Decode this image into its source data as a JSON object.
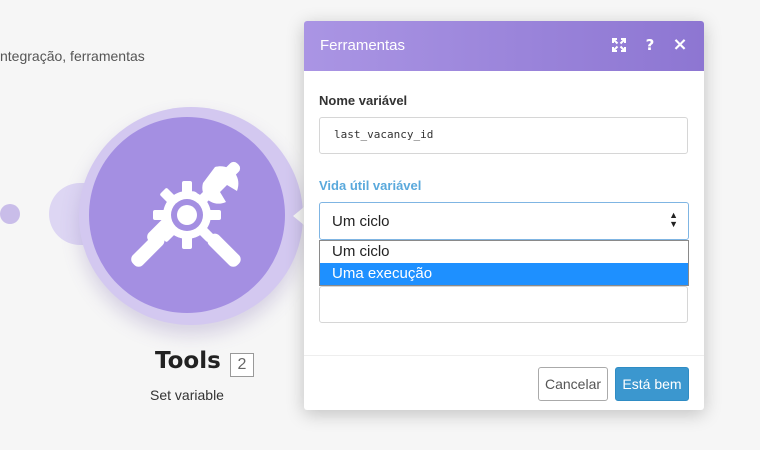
{
  "breadcrumb": "ntegração, ferramentas",
  "module": {
    "title": "Tools",
    "number": "2",
    "subtitle": "Set variable",
    "icon": "tools-gear-icon",
    "color": "#a48fe2"
  },
  "dialog": {
    "title": "Ferramentas",
    "header_icons": [
      "expand-icon",
      "help-icon",
      "close-icon"
    ],
    "help_glyph": "?",
    "close_glyph": "×",
    "field_name_label": "Nome variável",
    "field_name_value": "last_vacancy_id",
    "lifetime_label": "Vida útil variável",
    "lifetime_selected": "Um ciclo",
    "lifetime_options": [
      "Um ciclo",
      "Uma execução"
    ],
    "highlighted_option": "Uma execução",
    "value_field": "",
    "cancel_label": "Cancelar",
    "ok_label": "Está bem",
    "accent_color": "#3b97cf",
    "header_gradient": [
      "#aa95e4",
      "#8d76d2"
    ]
  }
}
